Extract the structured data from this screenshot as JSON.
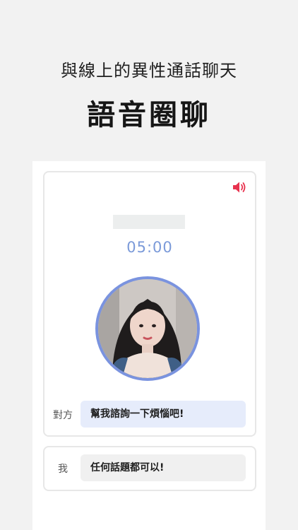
{
  "header": {
    "subtitle": "與線上的異性通話聊天",
    "title": "語音圈聊"
  },
  "call": {
    "speaker_icon": "speaker-volume-icon",
    "timer": "05:00",
    "avatar": "profile-photo",
    "partner_label": "對方",
    "partner_message": "幫我諮詢一下煩惱吧!"
  },
  "me": {
    "label": "我",
    "message": "任何話題都可以!"
  },
  "colors": {
    "background": "#f2f2f2",
    "accent": "#7a93df",
    "speaker_icon": "#e8334f",
    "partner_bubble": "#e6ecfb",
    "me_bubble": "#f0f0f0"
  }
}
